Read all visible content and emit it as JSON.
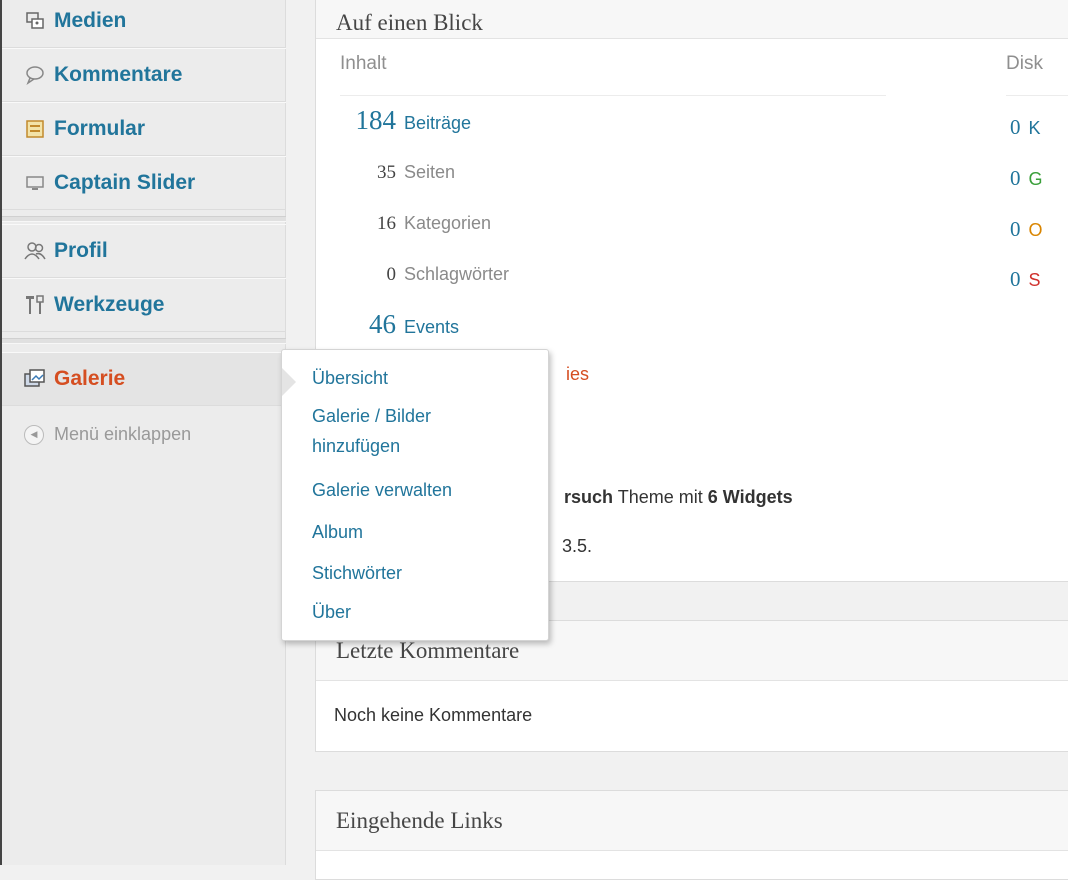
{
  "sidebar": {
    "items": [
      {
        "label": "Medien",
        "icon": "media-icon"
      },
      {
        "label": "Kommentare",
        "icon": "comment-icon"
      },
      {
        "label": "Formular",
        "icon": "form-icon"
      },
      {
        "label": "Captain Slider",
        "icon": "slider-icon"
      },
      {
        "label": "Profil",
        "icon": "profile-icon"
      },
      {
        "label": "Werkzeuge",
        "icon": "tools-icon"
      },
      {
        "label": "Galerie",
        "icon": "gallery-icon"
      }
    ],
    "collapse_label": "Menü einklappen"
  },
  "glance": {
    "title": "Auf einen Blick",
    "content_title": "Inhalt",
    "discussion_title": "Disk",
    "rows": [
      {
        "num": "184",
        "label": "Beiträge"
      },
      {
        "num": "35",
        "label": "Seiten"
      },
      {
        "num": "16",
        "label": "Kategorien"
      },
      {
        "num": "0",
        "label": "Schlagwörter"
      },
      {
        "num": "46",
        "label": "Events"
      }
    ],
    "partial_gallery": "ies",
    "theme_bold": "rsuch",
    "theme_text": " Theme mit ",
    "theme_widgets": "6 Widgets",
    "version_partial": "3.5.",
    "discussion": [
      {
        "num": "0",
        "label": "K",
        "color": "#21759b"
      },
      {
        "num": "0",
        "label": "G",
        "color": "#3a9f3a"
      },
      {
        "num": "0",
        "label": "O",
        "color": "#d98500"
      },
      {
        "num": "0",
        "label": "S",
        "color": "#d0312d"
      }
    ]
  },
  "flyout": {
    "items": [
      "Übersicht",
      "Galerie / Bilder",
      "hinzufügen",
      "Galerie verwalten",
      "Album",
      "Stichwörter",
      "Über"
    ]
  },
  "comments": {
    "title": "Letzte Kommentare",
    "empty": "Noch keine Kommentare"
  },
  "links": {
    "title": "Eingehende Links"
  }
}
